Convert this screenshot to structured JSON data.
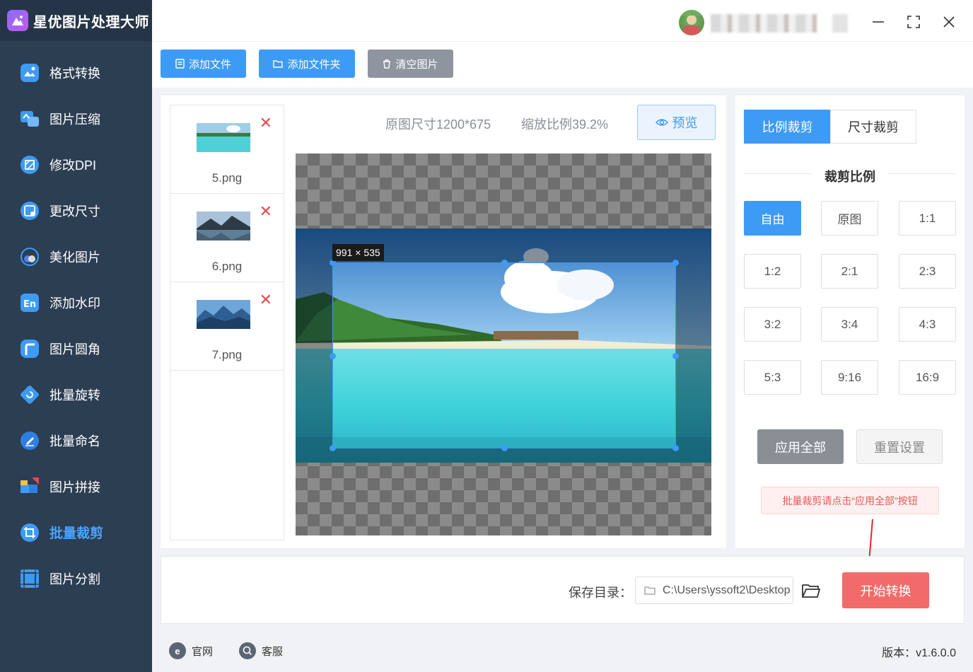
{
  "app": {
    "title": "星优图片处理大师"
  },
  "window": {
    "minimize_icon": "minimize-icon",
    "maximize_icon": "maximize-icon",
    "close_icon": "close-icon"
  },
  "sidebar": {
    "items": [
      {
        "label": "格式转换",
        "icon": "format-convert-icon",
        "color": "#4aa3ff"
      },
      {
        "label": "图片压缩",
        "icon": "compress-icon",
        "color": "#4aa3ff"
      },
      {
        "label": "修改DPI",
        "icon": "dpi-icon",
        "color": "#4aa3ff"
      },
      {
        "label": "更改尺寸",
        "icon": "resize-icon",
        "color": "#4aa3ff"
      },
      {
        "label": "美化图片",
        "icon": "beautify-icon",
        "color": "#4aa3ff"
      },
      {
        "label": "添加水印",
        "icon": "watermark-icon",
        "color": "#4aa3ff"
      },
      {
        "label": "图片圆角",
        "icon": "round-corner-icon",
        "color": "#4aa3ff"
      },
      {
        "label": "批量旋转",
        "icon": "rotate-icon",
        "color": "#4aa3ff"
      },
      {
        "label": "批量命名",
        "icon": "rename-icon",
        "color": "#4aa3ff"
      },
      {
        "label": "图片拼接",
        "icon": "splice-icon",
        "color": "#4aa3ff"
      },
      {
        "label": "批量裁剪",
        "icon": "crop-icon",
        "color": "#4aa3ff",
        "active": true
      },
      {
        "label": "图片分割",
        "icon": "split-icon",
        "color": "#4aa3ff"
      }
    ]
  },
  "toolbar": {
    "add_file": "添加文件",
    "add_folder": "添加文件夹",
    "clear": "清空图片"
  },
  "files": [
    {
      "name": "5.png"
    },
    {
      "name": "6.png"
    },
    {
      "name": "7.png"
    }
  ],
  "preview": {
    "original_size": "原图尺寸1200*675",
    "zoom": "缩放比例39.2%",
    "preview_label": "预览",
    "crop_size": "991 × 535"
  },
  "crop_panel": {
    "tab_ratio": "比例裁剪",
    "tab_size": "尺寸裁剪",
    "section_title": "裁剪比例",
    "ratios": [
      "自由",
      "原图",
      "1:1",
      "1:2",
      "2:1",
      "2:3",
      "3:2",
      "3:4",
      "4:3",
      "5:3",
      "9:16",
      "16:9"
    ],
    "selected_ratio": "自由",
    "apply_all": "应用全部",
    "reset": "重置设置",
    "hint": "批量裁剪请点击“应用全部”按钮"
  },
  "output": {
    "save_label": "保存目录：",
    "save_path": "C:\\Users\\yssoft2\\Desktop",
    "start": "开始转换"
  },
  "footer": {
    "website": "官网",
    "support": "客服",
    "version": "版本：v1.6.0.0"
  },
  "colors": {
    "accent": "#3d9bf5",
    "sidebar": "#2c3e52",
    "danger": "#f26b6b"
  }
}
